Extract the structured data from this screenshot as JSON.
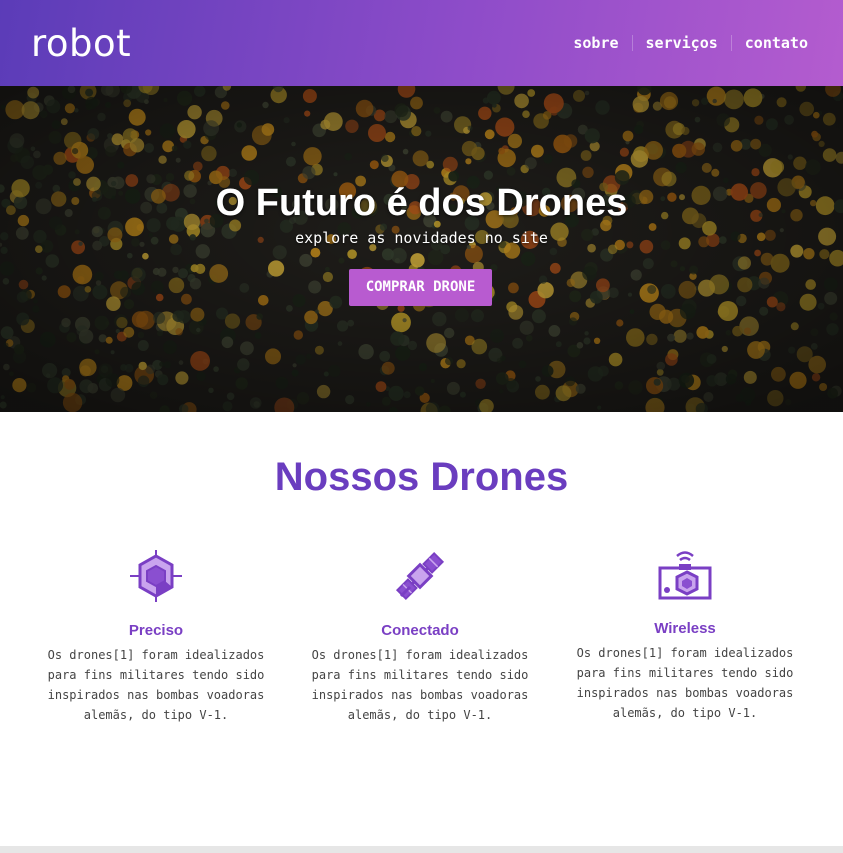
{
  "header": {
    "logo": "robot",
    "nav": [
      "sobre",
      "serviços",
      "contato"
    ]
  },
  "hero": {
    "title": "O Futuro é dos Drones",
    "subtitle": "explore as novidades no site",
    "button": "COMPRAR DRONE"
  },
  "section": {
    "title": "Nossos Drones",
    "features": [
      {
        "icon": "precision-target-icon",
        "title": "Preciso",
        "text": "Os drones[1] foram idealizados para fins militares tendo sido inspirados nas bombas voadoras alemãs, do tipo V-1."
      },
      {
        "icon": "satellite-icon",
        "title": "Conectado",
        "text": "Os drones[1] foram idealizados para fins militares tendo sido inspirados nas bombas voadoras alemãs, do tipo V-1."
      },
      {
        "icon": "wireless-camera-icon",
        "title": "Wireless",
        "text": "Os drones[1] foram idealizados para fins militares tendo sido inspirados nas bombas voadoras alemãs, do tipo V-1."
      }
    ]
  },
  "colors": {
    "accent": "#6a3dbf",
    "button": "#b85bd0",
    "header_start": "#5b3cb8",
    "header_end": "#b45ccf"
  }
}
